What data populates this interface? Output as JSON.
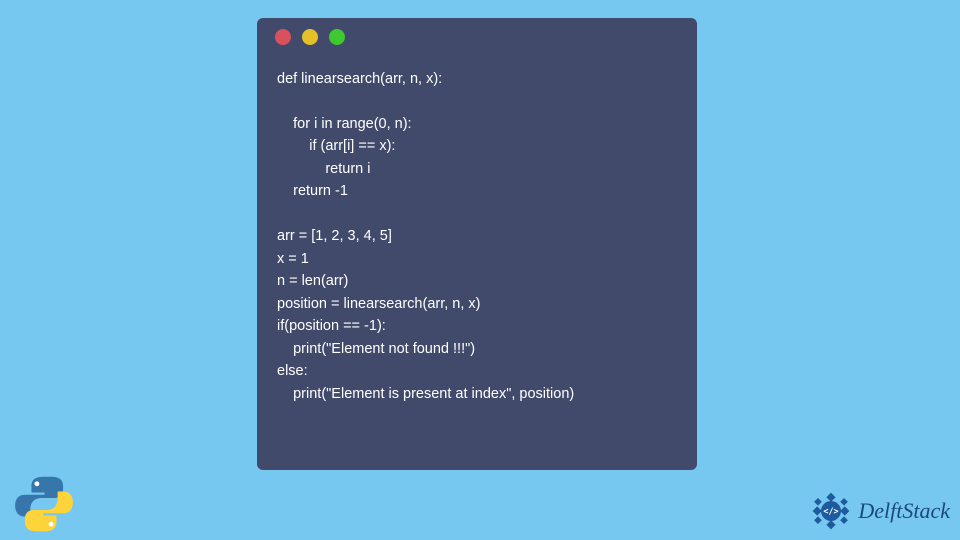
{
  "window": {
    "dot_red": "#d9515d",
    "dot_yellow": "#e5c02a",
    "dot_green": "#3ec930",
    "bg": "#414a6b"
  },
  "code": {
    "line1": "def linearsearch(arr, n, x):",
    "line2": "",
    "line3": "    for i in range(0, n):",
    "line4": "        if (arr[i] == x):",
    "line5": "            return i",
    "line6": "    return -1",
    "line7": "",
    "line8": "arr = [1, 2, 3, 4, 5]",
    "line9": "x = 1",
    "line10": "n = len(arr)",
    "line11": "position = linearsearch(arr, n, x)",
    "line12": "if(position == -1):",
    "line13": "    print(\"Element not found !!!\")",
    "line14": "else:",
    "line15": "    print(\"Element is present at index\", position)"
  },
  "branding": {
    "delft_name": "DelftStack"
  }
}
